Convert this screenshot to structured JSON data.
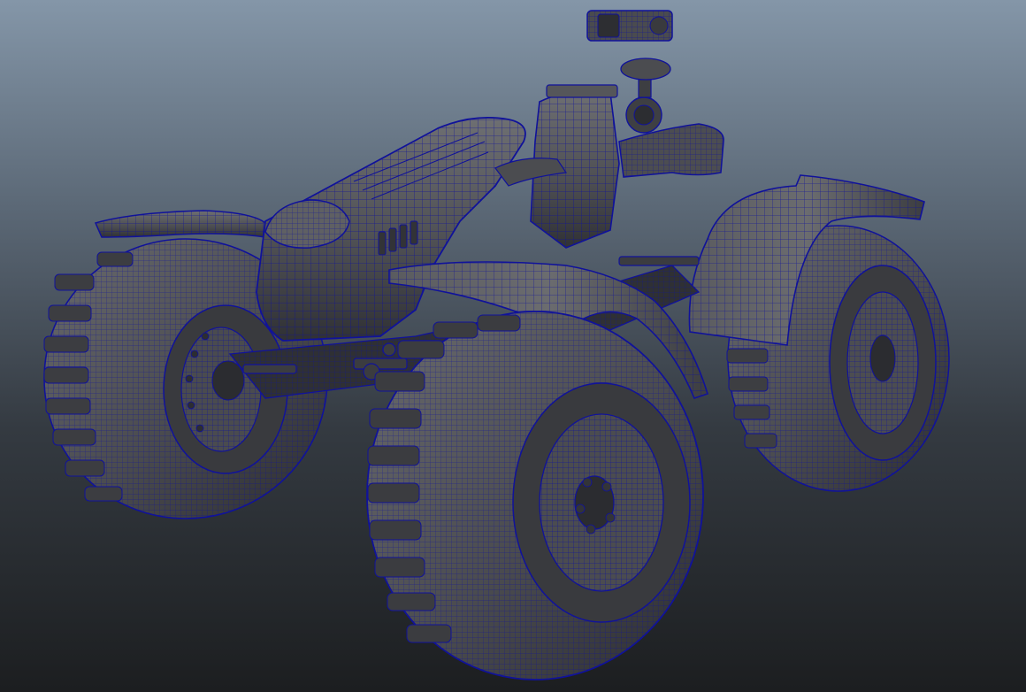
{
  "viewport": {
    "mode": "wireframe-on-shaded",
    "background_top": "#8496a8",
    "background_bottom": "#1c1e20"
  },
  "model": {
    "type": "all-terrain-quad-vehicle",
    "wire_color": "#10129a",
    "surface_color": "#4f5054",
    "surface_highlight": "#6c6d70",
    "surface_shadow": "#2e2f33",
    "wheel_count": 4
  }
}
